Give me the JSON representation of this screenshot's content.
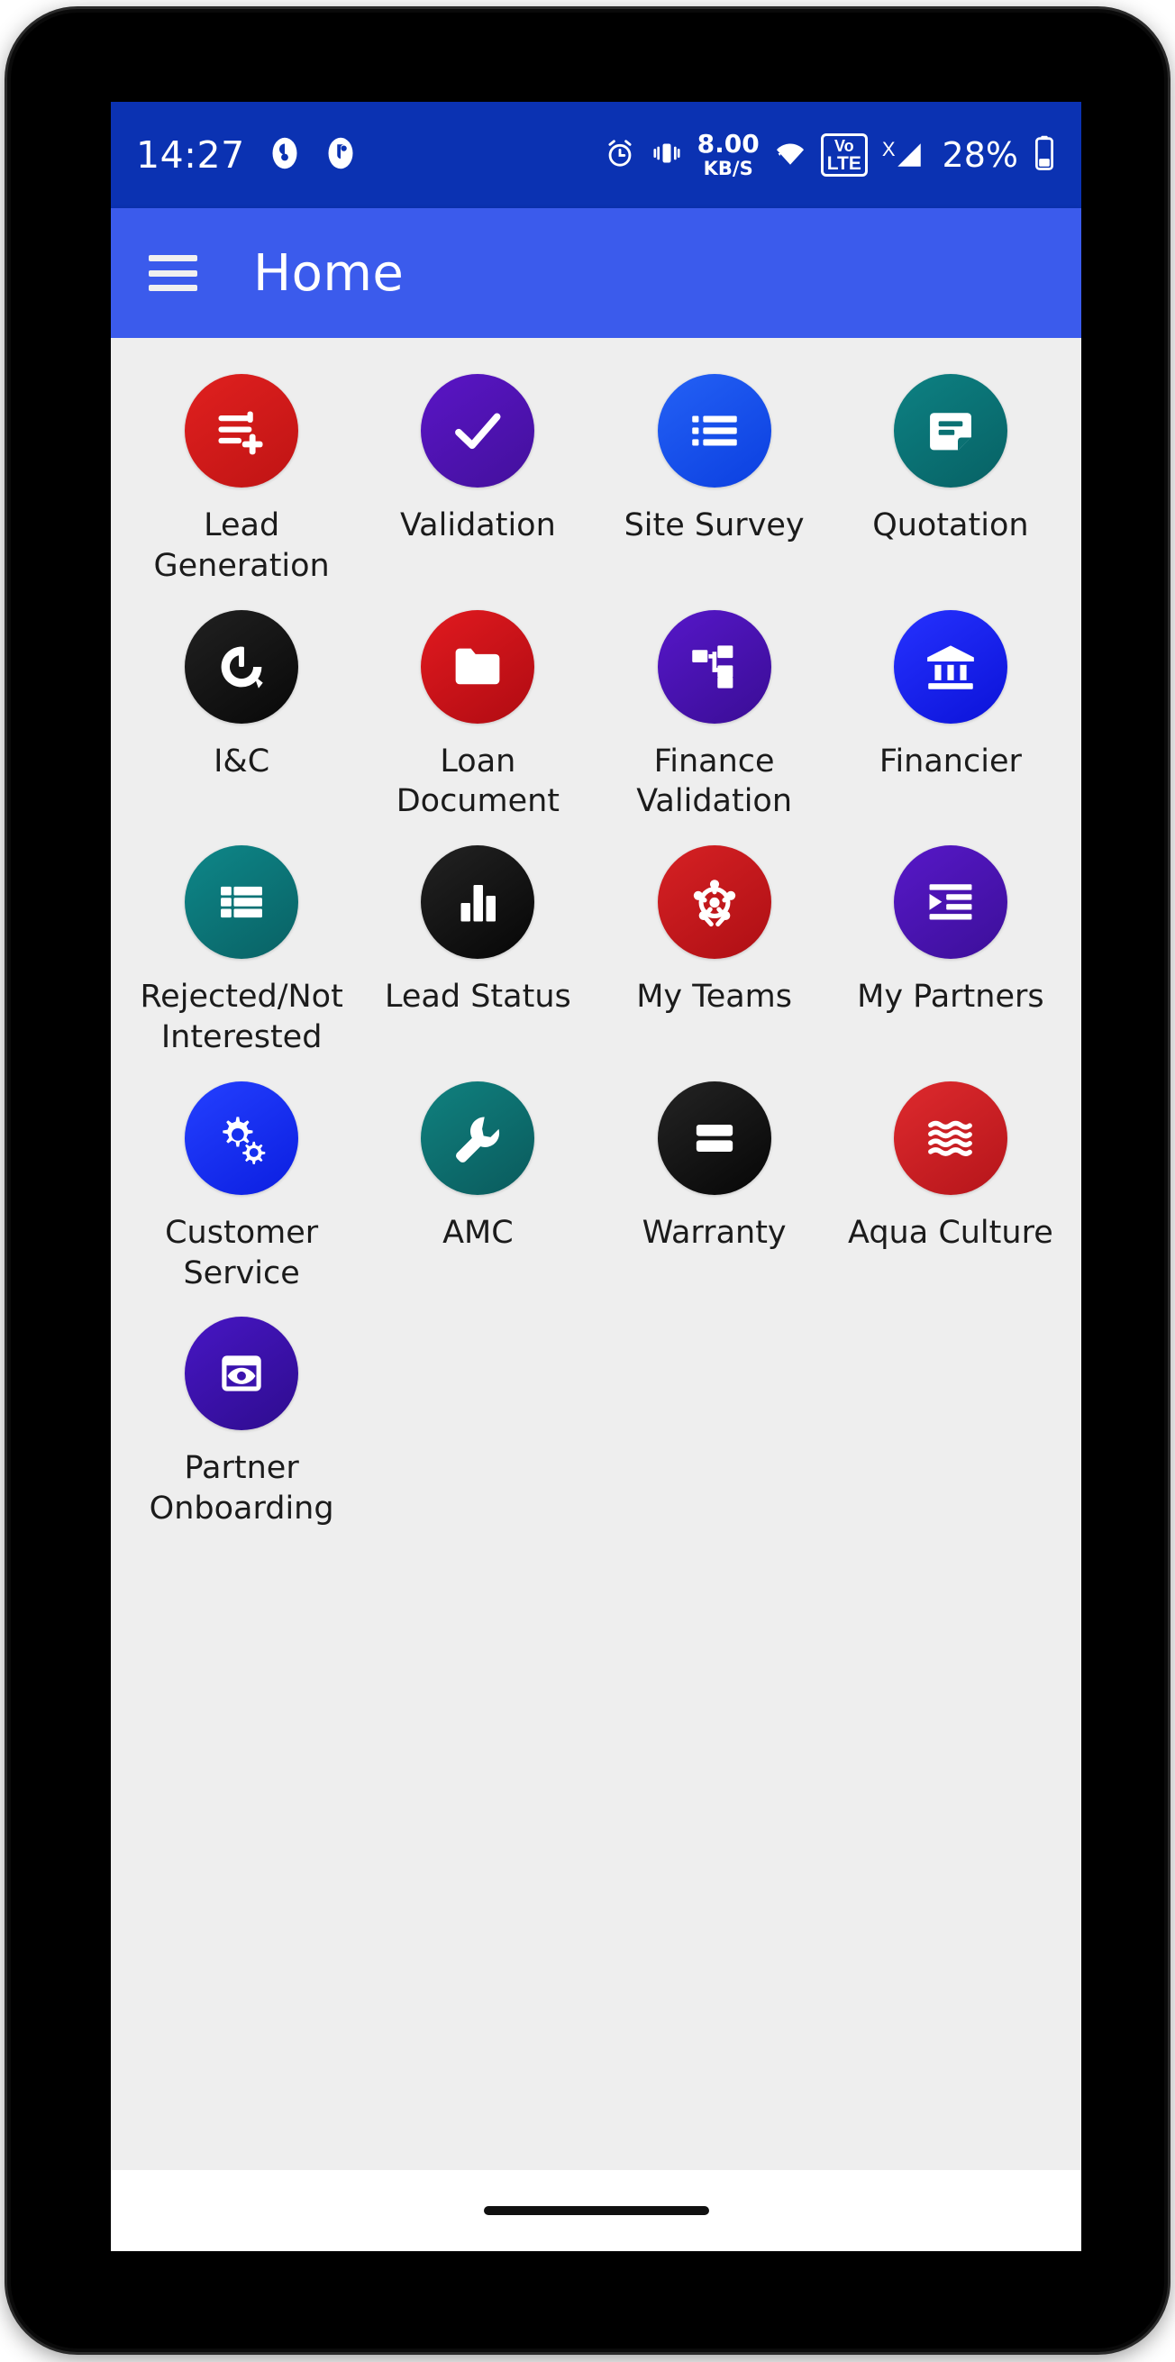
{
  "statusbar": {
    "time": "14:27",
    "net_speed_value": "8.00",
    "net_speed_unit": "KB/S",
    "volte_top": "VoLTE",
    "volte_line1": "Vo",
    "volte_line2": "LTE",
    "signal_x": "X",
    "battery_percent": "28%",
    "icons": [
      "location-icon",
      "app-badge-icon",
      "alarm-icon",
      "vibrate-icon",
      "wifi-icon",
      "volte-icon",
      "signal-bars-icon",
      "battery-icon"
    ],
    "bg_color": "#0b32b2"
  },
  "appbar": {
    "title": "Home",
    "menu_icon": "hamburger-menu-icon",
    "bg_color": "#3b5bec"
  },
  "grid": {
    "tiles": [
      {
        "label": "Lead Generation",
        "icon": "playlist-add-icon",
        "color": "#d51d1d"
      },
      {
        "label": "Validation",
        "icon": "check-icon",
        "color": "#4d11ae"
      },
      {
        "label": "Site Survey",
        "icon": "list-bullets-icon",
        "color": "#1251ef"
      },
      {
        "label": "Quotation",
        "icon": "note-document-icon",
        "color": "#0b7173"
      },
      {
        "label": "I&C",
        "icon": "donut-progress-icon",
        "color": "#141414"
      },
      {
        "label": "Loan Document",
        "icon": "folder-icon",
        "color": "#cc1018"
      },
      {
        "label": "Finance Validation",
        "icon": "account-tree-icon",
        "color": "#4711ab"
      },
      {
        "label": "Financier",
        "icon": "bank-icon",
        "color": "#1620f0"
      },
      {
        "label": "Rejected/Not Interested",
        "icon": "table-grid-icon",
        "color": "#0d7577"
      },
      {
        "label": "Lead Status",
        "icon": "bar-chart-icon",
        "color": "#141414"
      },
      {
        "label": "My Teams",
        "icon": "hub-network-icon",
        "color": "#c5181c"
      },
      {
        "label": "My Partners",
        "icon": "format-indent-icon",
        "color": "#4a15b0"
      },
      {
        "label": "Customer Service",
        "icon": "gears-settings-icon",
        "color": "#1531ef"
      },
      {
        "label": "AMC",
        "icon": "wrench-icon",
        "color": "#116b6c"
      },
      {
        "label": "Warranty",
        "icon": "two-bars-icon",
        "color": "#141414"
      },
      {
        "label": "Aqua Culture",
        "icon": "waves-icon",
        "color": "#cc2126"
      },
      {
        "label": "Partner Onboarding",
        "icon": "preview-eye-icon",
        "color": "#3b13ae"
      }
    ]
  },
  "navbar": {
    "home_indicator": "home-indicator-pill"
  }
}
